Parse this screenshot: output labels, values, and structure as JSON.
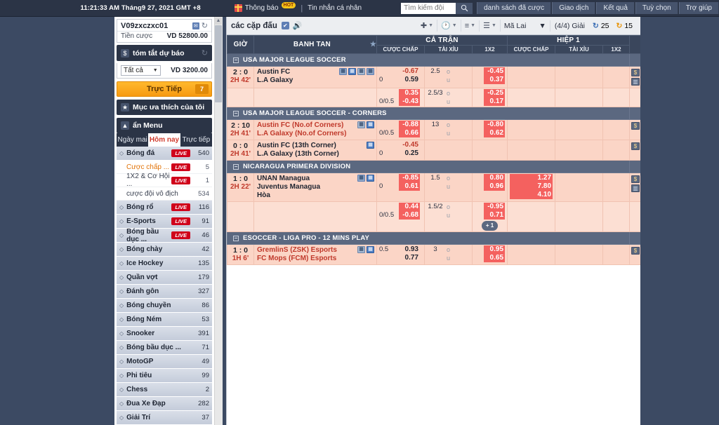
{
  "topbar": {
    "clock": "11:21:33 AM Tháng9 27, 2021 GMT +8",
    "notification_label": "Thông báo",
    "notification_badge": "HOT",
    "separator": "|",
    "personal_message": "Tin nhắn cá nhân",
    "search_placeholder": "Tìm kiếm đội",
    "search_value": "",
    "search_icon": "magnifier-icon",
    "nav": [
      {
        "label": "danh sách đã cược"
      },
      {
        "label": "Giao dịch"
      },
      {
        "label": "Kết quả"
      },
      {
        "label": "Tuỳ chọn"
      },
      {
        "label": "Trợ giúp"
      }
    ]
  },
  "sidebar": {
    "account": {
      "username": "V09zxczxc01",
      "balance_label": "Tiền cược",
      "balance_value": "VD 52800.00",
      "mail_icon": "envelope-icon",
      "refresh_icon": "refresh-icon"
    },
    "summary": {
      "title": "tóm tắt dự báo",
      "badge": "$",
      "refresh_icon": "refresh-icon",
      "filter_value": "Tất cả",
      "amount": "VD 3200.00"
    },
    "live_button": {
      "label": "Trực Tiếp",
      "count": "7"
    },
    "favorites": {
      "label": "Mục ưa thích của tôi",
      "icon": "star-icon"
    },
    "menu_header": {
      "label": "ẩn Menu",
      "icon": "chevron-up-icon"
    },
    "day_tabs": [
      {
        "label": "Ngày mai",
        "active": false
      },
      {
        "label": "Hôm nay",
        "active": true
      },
      {
        "label": "Trực tiếp",
        "active": false
      }
    ],
    "live_tag": "LIVE",
    "sports": [
      {
        "name": "Bóng đá",
        "live": true,
        "count": "540",
        "subs": [
          {
            "name": "Cược chấp ...",
            "live": true,
            "count": "5",
            "highlight": true
          },
          {
            "name": "1X2 & Cơ Hội ...",
            "live": true,
            "count": "1",
            "highlight": false
          },
          {
            "name": "cược đội vô địch",
            "live": false,
            "count": "534",
            "highlight": false
          }
        ]
      },
      {
        "name": "Bóng rổ",
        "live": true,
        "count": "116",
        "subs": []
      },
      {
        "name": "E-Sports",
        "live": true,
        "count": "91",
        "subs": []
      },
      {
        "name": "Bóng bầu dục ...",
        "live": true,
        "count": "46",
        "subs": []
      },
      {
        "name": "Bóng chày",
        "live": false,
        "count": "42",
        "subs": []
      },
      {
        "name": "Ice Hockey",
        "live": false,
        "count": "135",
        "subs": []
      },
      {
        "name": "Quần vợt",
        "live": false,
        "count": "179",
        "subs": []
      },
      {
        "name": "Đánh gôn",
        "live": false,
        "count": "327",
        "subs": []
      },
      {
        "name": "Bóng chuyền",
        "live": false,
        "count": "86",
        "subs": []
      },
      {
        "name": "Bóng Ném",
        "live": false,
        "count": "53",
        "subs": []
      },
      {
        "name": "Snooker",
        "live": false,
        "count": "391",
        "subs": []
      },
      {
        "name": "Bóng bầu dục ...",
        "live": false,
        "count": "71",
        "subs": []
      },
      {
        "name": "MotoGP",
        "live": false,
        "count": "49",
        "subs": []
      },
      {
        "name": "Phi tiêu",
        "live": false,
        "count": "99",
        "subs": []
      },
      {
        "name": "Chess",
        "live": false,
        "count": "2",
        "subs": []
      },
      {
        "name": "Đua Xe Đạp",
        "live": false,
        "count": "282",
        "subs": []
      },
      {
        "name": "Giải Trí",
        "live": false,
        "count": "37",
        "subs": []
      }
    ]
  },
  "main": {
    "toolbar": {
      "title": "các cặp đấu",
      "checkbox_icon": "checkbox-checked-icon",
      "speaker_icon": "speaker-icon",
      "add_icon": "plus-icon",
      "clock_icon": "clock-icon",
      "sort_icon": "sort-icon",
      "list_icon": "list-icon",
      "odds_format": "Mã Lai",
      "leagues_label": "(4/4) Giải",
      "refresh_count": "25",
      "timer_count": "15",
      "refresh_icon": "refresh-blue-icon",
      "timer_icon": "refresh-orange-icon"
    },
    "table": {
      "headers": {
        "time": "GIỜ",
        "teams": "BANH TAN",
        "fulltime": "CẢ TRẬN",
        "firsthalf": "HIỆP 1",
        "handicap": "CƯỢC CHẤP",
        "overunder": "TÀI XỈU",
        "onexwo": "1X2",
        "star_icon": "star-icon"
      },
      "sections": [
        {
          "league": "USA MAJOR LEAGUE SOCCER",
          "collapse_icon": "minus-icon",
          "corner_icon": "C",
          "matches": [
            {
              "score": "2 : 0",
              "time": "2H 42'",
              "team1": "Austin FC",
              "team2": "L.A Galaxy",
              "team_color": "dark",
              "icons": [
                "ic-tv",
                "ic-st",
                "ic-ln",
                "ic-tv"
              ],
              "ft_handicap": {
                "line2": "0",
                "odd1": "-0.67",
                "odd1_hl": false,
                "odd2": "0.59",
                "odd2_hl": false
              },
              "ft_ou": {
                "point": "2.5",
                "odd1": "",
                "odd2": ""
              },
              "ft_1x2": {
                "odd1": "-0.45",
                "odd1_hl": true,
                "odd2": "0.37",
                "odd2_hl": true
              },
              "right_icons": [
                "$",
                "chart"
              ]
            },
            {
              "score": "",
              "time": "",
              "team1": "",
              "team2": "",
              "team_color": "dark",
              "icons": [],
              "ft_handicap": {
                "line2": "0/0.5",
                "odd1": "0.35",
                "odd1_hl": true,
                "odd2": "-0.43",
                "odd2_hl": true
              },
              "ft_ou": {
                "point": "2.5/3",
                "odd1": "",
                "odd2": ""
              },
              "ft_1x2": {
                "odd1": "-0.25",
                "odd1_hl": true,
                "odd2": "0.17",
                "odd2_hl": true
              },
              "right_icons": []
            }
          ]
        },
        {
          "league": "USA MAJOR LEAGUE SOCCER - CORNERS",
          "collapse_icon": "minus-icon",
          "corner_icon": "C",
          "matches": [
            {
              "score": "2 : 10",
              "time": "2H 41'",
              "team1": "Austin FC (No.of Corners)",
              "team2": "L.A Galaxy (No.of Corners)",
              "team_color": "red",
              "icons": [
                "ic-ln",
                "ic-st"
              ],
              "ft_handicap": {
                "line2": "0/0.5",
                "odd1": "-0.88",
                "odd1_hl": true,
                "odd2": "0.66",
                "odd2_hl": true
              },
              "ft_ou": {
                "point": "13",
                "odd1": "",
                "odd2": ""
              },
              "ft_1x2": {
                "odd1": "-0.80",
                "odd1_hl": true,
                "odd2": "0.62",
                "odd2_hl": true
              },
              "right_icons": [
                "$"
              ]
            },
            {
              "score": "0 : 0",
              "time": "2H 41'",
              "team1": "Austin FC (13th Corner)",
              "team2": "L.A Galaxy (13th Corner)",
              "team_color": "dark",
              "icons": [
                "ic-st"
              ],
              "ft_handicap": {
                "line2": "0",
                "odd1": "-0.45",
                "odd1_hl": false,
                "odd2": "0.25",
                "odd2_hl": false
              },
              "ft_ou": {
                "point": "",
                "odd1": "",
                "odd2": ""
              },
              "ft_1x2": {
                "odd1": "",
                "odd1_hl": false,
                "odd2": "",
                "odd2_hl": false
              },
              "right_icons": [
                "$"
              ]
            }
          ]
        },
        {
          "league": "NICARAGUA PRIMERA DIVISION",
          "collapse_icon": "minus-icon",
          "corner_icon": "C",
          "matches": [
            {
              "score": "1 : 0",
              "time": "2H 22'",
              "team1": "UNAN Managua",
              "team2": "Juventus Managua",
              "team3": "Hòa",
              "team_color": "dark",
              "icons": [
                "ic-tv",
                "ic-st"
              ],
              "ft_handicap": {
                "line2": "0",
                "odd1": "-0.85",
                "odd1_hl": true,
                "odd2": "0.61",
                "odd2_hl": true
              },
              "ft_ou": {
                "point": "1.5",
                "odd1": "",
                "odd2": ""
              },
              "ft_1x2": {
                "odd1": "0.80",
                "odd1_hl": true,
                "odd2": "0.96",
                "odd2_hl": true
              },
              "ft_x": {
                "v1": "1.27",
                "v2": "7.80",
                "v3": "4.10"
              },
              "right_icons": [
                "$",
                "chart"
              ]
            },
            {
              "score": "",
              "time": "",
              "team1": "",
              "team2": "",
              "team_color": "dark",
              "icons": [],
              "ft_handicap": {
                "line2": "0/0.5",
                "odd1": "0.44",
                "odd1_hl": true,
                "odd2": "-0.68",
                "odd2_hl": true
              },
              "ft_ou": {
                "point": "1.5/2",
                "odd1": "",
                "odd2": ""
              },
              "ft_1x2": {
                "odd1": "-0.95",
                "odd1_hl": true,
                "odd2": "0.71",
                "odd2_hl": true
              },
              "plus_more": "+ 1",
              "right_icons": []
            }
          ]
        },
        {
          "league": "ESOCCER - LIGA PRO - 12 MINS PLAY",
          "collapse_icon": "minus-icon",
          "corner_icon": "C",
          "matches": [
            {
              "score": "1 : 0",
              "time": "1H 6'",
              "team1": "GremlinS (ZSK) Esports",
              "team2": "FC Mops (FCM) Esports",
              "team_color": "red",
              "icons": [
                "ic-ln",
                "ic-st"
              ],
              "ft_handicap": {
                "line1": "0.5",
                "line2": "",
                "odd1": "0.93",
                "odd1_hl": false,
                "odd2": "0.77",
                "odd2_hl": false
              },
              "ft_ou": {
                "point": "3",
                "odd1": "",
                "odd2": ""
              },
              "ft_1x2": {
                "odd1": "0.95",
                "odd1_hl": true,
                "odd2": "0.65",
                "odd2_hl": true
              },
              "right_icons": [
                "$"
              ]
            }
          ]
        }
      ]
    }
  }
}
